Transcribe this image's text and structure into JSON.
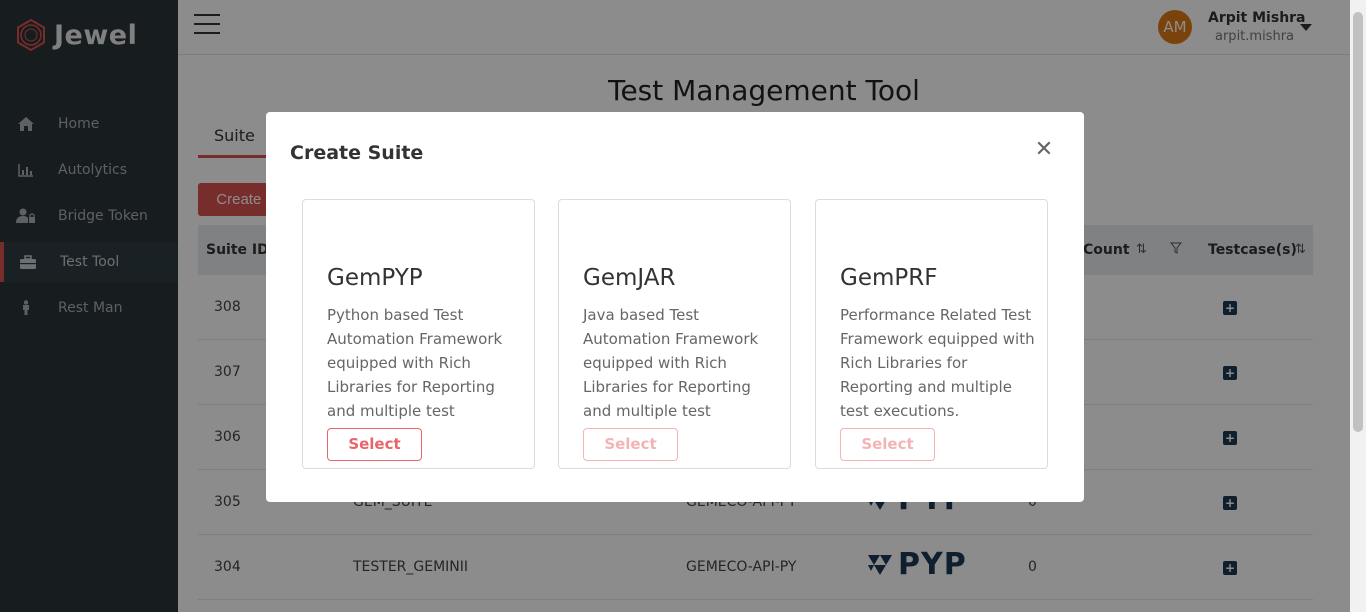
{
  "app": {
    "name": "Jewel"
  },
  "sidebar": {
    "items": [
      {
        "label": "Home",
        "icon": "home-icon"
      },
      {
        "label": "Autolytics",
        "icon": "chart-icon"
      },
      {
        "label": "Bridge Token",
        "icon": "user-lock-icon"
      },
      {
        "label": "Test Tool",
        "icon": "toolbox-icon",
        "active": true
      },
      {
        "label": "Rest Man",
        "icon": "person-icon"
      }
    ]
  },
  "header": {
    "avatar_initials": "AM",
    "user_name": "Arpit Mishra",
    "user_login": "arpit.mishra"
  },
  "main": {
    "title": "Test Management Tool",
    "tab_suite": "Suite",
    "create_button": "Create Suite",
    "table": {
      "headers": {
        "suite_id": "Suite ID",
        "count": "Count",
        "testcases": "Testcase(s)"
      },
      "rows": [
        {
          "id": "308",
          "name": "",
          "project": "",
          "count": ""
        },
        {
          "id": "307",
          "name": "",
          "project": "",
          "count": ""
        },
        {
          "id": "306",
          "name": "",
          "project": "",
          "count": ""
        },
        {
          "id": "305",
          "name": "GEM_SUITE",
          "project": "GEMECO-API-PY",
          "count": "0"
        },
        {
          "id": "304",
          "name": "TESTER_GEMINII",
          "project": "GEMECO-API-PY",
          "count": "0"
        }
      ]
    }
  },
  "modal": {
    "title": "Create Suite",
    "cards": [
      {
        "title": "GemPYP",
        "description": "Python based Test Automation Framework equipped with Rich Libraries for Reporting and multiple test executions.",
        "button": "Select",
        "enabled": true
      },
      {
        "title": "GemJAR",
        "description": "Java based Test Automation Framework equipped with Rich Libraries for Reporting and multiple test executions.",
        "button": "Select",
        "enabled": false
      },
      {
        "title": "GemPRF",
        "description": "Performance Related Test Framework equipped with Rich Libraries for Reporting and multiple test executions.",
        "button": "Select",
        "enabled": false
      }
    ]
  },
  "colors": {
    "sidebar_bg": "#2a3338",
    "accent": "#d9534f",
    "avatar_bg": "#e07b17",
    "brand_dark": "#1d3a53"
  }
}
